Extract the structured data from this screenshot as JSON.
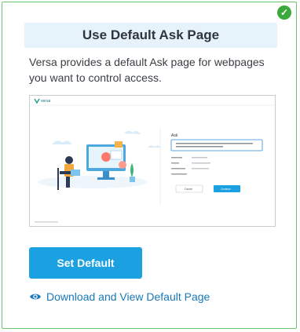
{
  "card": {
    "status_icon": "checkmark-circle-icon",
    "status_color": "#3aa93a",
    "title": "Use Default Ask Page",
    "description": "Versa provides a default Ask page for webpages you want to control access.",
    "preview": {
      "brand": "versa",
      "heading": "Ask",
      "cancel_label": "Cancel",
      "continue_label": "Continue"
    },
    "primary_button": "Set Default",
    "link": {
      "icon": "eye-icon",
      "label": "Download and View Default Page"
    }
  },
  "colors": {
    "border": "#6cc46c",
    "title_bg": "#e6f3fb",
    "button": "#1ba1e2",
    "link": "#1878b8"
  }
}
